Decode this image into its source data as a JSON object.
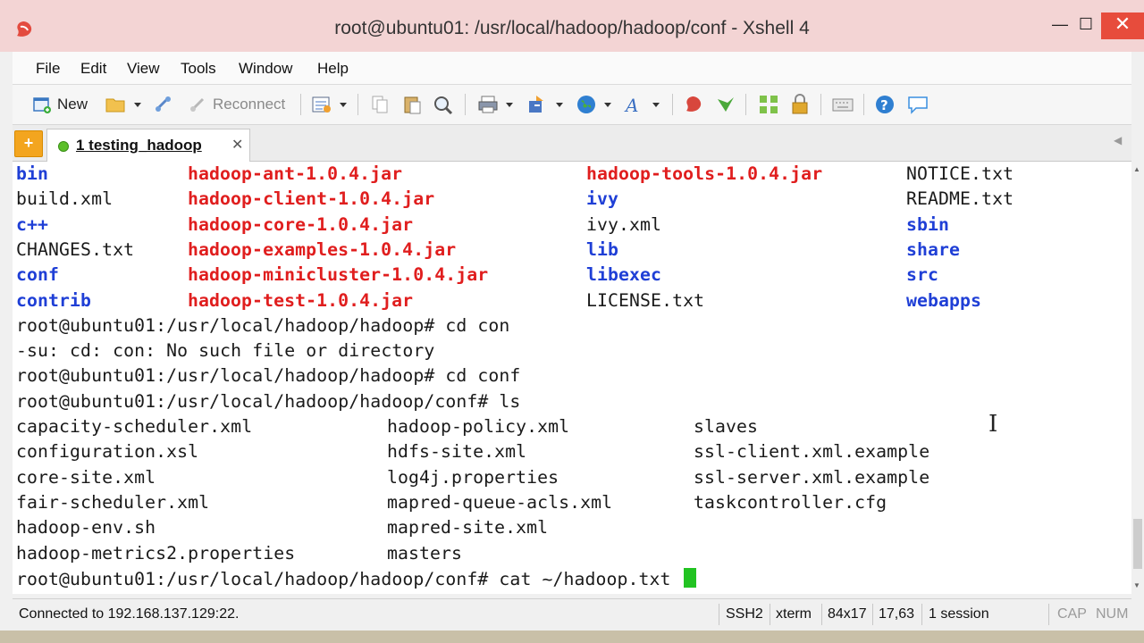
{
  "window": {
    "title": "root@ubuntu01: /usr/local/hadoop/hadoop/conf - Xshell 4",
    "minimize_glyph": "—",
    "maximize_glyph": "☐",
    "close_glyph": "✕"
  },
  "menu": [
    "File",
    "Edit",
    "View",
    "Tools",
    "Window",
    "Help"
  ],
  "toolbar": {
    "new_label": "New",
    "reconnect_label": "Reconnect"
  },
  "tabs": {
    "add_glyph": "+",
    "active_label": "1 testing_hadoop",
    "close_glyph": "✕",
    "nav_glyph": "◀"
  },
  "terminal": {
    "listing": [
      [
        "bin",
        "hadoop-ant-1.0.4.jar",
        "hadoop-tools-1.0.4.jar",
        "NOTICE.txt"
      ],
      [
        "build.xml",
        "hadoop-client-1.0.4.jar",
        "ivy",
        "README.txt"
      ],
      [
        "c++",
        "hadoop-core-1.0.4.jar",
        "ivy.xml",
        "sbin"
      ],
      [
        "CHANGES.txt",
        "hadoop-examples-1.0.4.jar",
        "lib",
        "share"
      ],
      [
        "conf",
        "hadoop-minicluster-1.0.4.jar",
        "libexec",
        "src"
      ],
      [
        "contrib",
        "hadoop-test-1.0.4.jar",
        "LICENSE.txt",
        "webapps"
      ]
    ],
    "listing_colors": [
      [
        "blue",
        "red",
        "red",
        "plain"
      ],
      [
        "plain",
        "red",
        "blue",
        "plain"
      ],
      [
        "blue",
        "red",
        "plain",
        "blue"
      ],
      [
        "plain",
        "red",
        "blue",
        "blue"
      ],
      [
        "blue",
        "red",
        "blue",
        "blue"
      ],
      [
        "blue",
        "red",
        "plain",
        "blue"
      ]
    ],
    "lines": [
      "root@ubuntu01:/usr/local/hadoop/hadoop# cd con",
      "-su: cd: con: No such file or directory",
      "root@ubuntu01:/usr/local/hadoop/hadoop# cd conf",
      "root@ubuntu01:/usr/local/hadoop/hadoop/conf# ls"
    ],
    "conf_listing": [
      [
        "capacity-scheduler.xml",
        "hadoop-policy.xml",
        "slaves"
      ],
      [
        "configuration.xsl",
        "hdfs-site.xml",
        "ssl-client.xml.example"
      ],
      [
        "core-site.xml",
        "log4j.properties",
        "ssl-server.xml.example"
      ],
      [
        "fair-scheduler.xml",
        "mapred-queue-acls.xml",
        "taskcontroller.cfg"
      ],
      [
        "hadoop-env.sh",
        "mapred-site.xml",
        ""
      ],
      [
        "hadoop-metrics2.properties",
        "masters",
        ""
      ]
    ],
    "prompt_line": "root@ubuntu01:/usr/local/hadoop/hadoop/conf# cat ~/hadoop.txt ",
    "colors": {
      "blue": "#1f3fd6",
      "red": "#e01e1e",
      "cursor": "#22c322"
    }
  },
  "status": {
    "connection": "Connected to 192.168.137.129:22.",
    "protocol": "SSH2",
    "terminal_type": "xterm",
    "size": "84x17",
    "cursor_pos": "17,63",
    "sessions": "1 session",
    "caps": "CAP",
    "num": "NUM"
  },
  "colors": {
    "titlebar": "#f3d4d4",
    "close_button": "#e74c3c",
    "tab_add": "#f3a51f"
  }
}
